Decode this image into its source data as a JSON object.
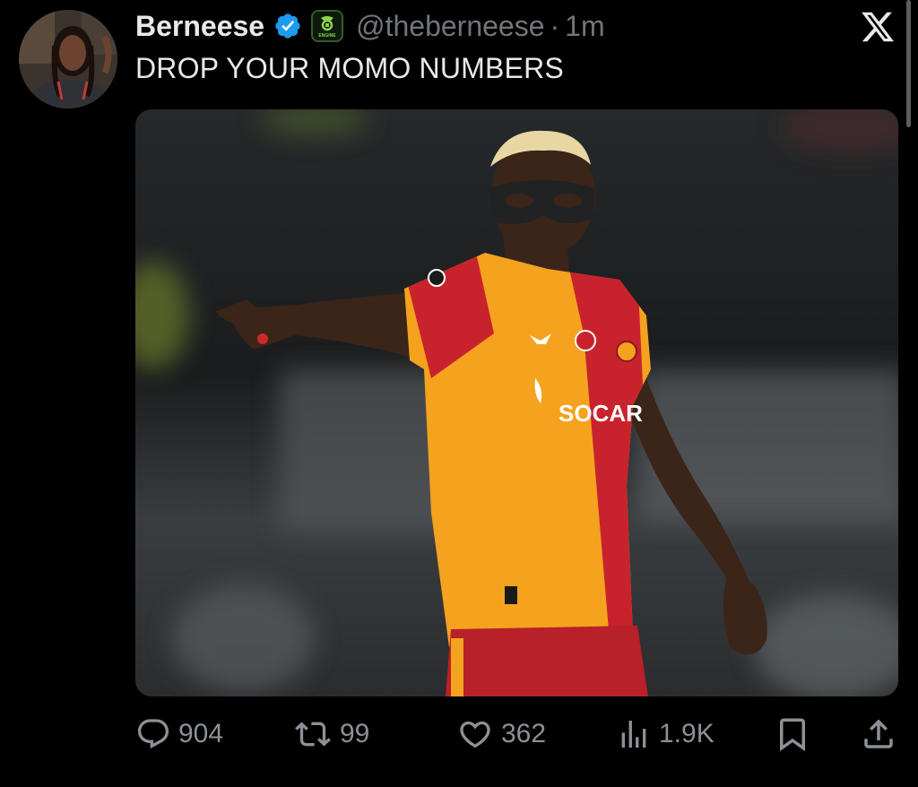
{
  "tweet": {
    "display_name": "Berneese",
    "handle": "@theberneese",
    "separator": "·",
    "time": "1m",
    "text": "DROP YOUR MOMO NUMBERS",
    "affiliate_badge_text": "ENGINE",
    "jersey_sponsor_text": "SOCAR"
  },
  "actions": {
    "replies": "904",
    "reposts": "99",
    "likes": "362",
    "views": "1.9K"
  },
  "icons": {
    "verified": "verified-badge-icon",
    "affiliate": "affiliate-badge-icon",
    "close": "x-logo-icon",
    "reply": "reply-icon",
    "repost": "repost-icon",
    "like": "heart-icon",
    "views": "views-bar-icon",
    "bookmark": "bookmark-icon",
    "share": "share-icon"
  },
  "colors": {
    "background": "#000000",
    "text_primary": "#e7e9ea",
    "text_secondary": "#71767b",
    "verified_blue": "#1d9bf0"
  }
}
